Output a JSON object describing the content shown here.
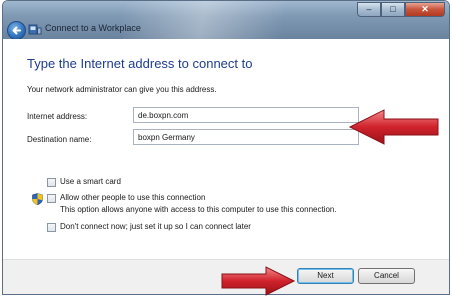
{
  "window": {
    "title": "Connect to a Workplace",
    "caption": {
      "minimize": "–",
      "maximize": "□",
      "close": "✕"
    }
  },
  "icons": {
    "back": "back-arrow-icon",
    "wizard": "network-wizard-icon",
    "shield": "uac-shield-icon",
    "annotation": "red-arrow-icon"
  },
  "main": {
    "heading": "Type the Internet address to connect to",
    "instruction": "Your network administrator can give you this address.",
    "internet_address": {
      "label": "Internet address:",
      "value": "de.boxpn.com"
    },
    "destination_name": {
      "label": "Destination name:",
      "value": "boxpn Germany"
    },
    "options": {
      "smart_card": {
        "label": "Use a smart card",
        "checked": false
      },
      "allow_others": {
        "label": "Allow other people to use this connection",
        "description": "This option allows anyone with access to this computer to use this connection.",
        "checked": false
      },
      "dont_connect": {
        "label": "Don't connect now; just set it up so I can connect later",
        "checked": false
      }
    }
  },
  "footer": {
    "next_label": "Next",
    "cancel_label": "Cancel"
  },
  "colors": {
    "heading": "#1e3d8f",
    "annotation_arrow": "#c0202a",
    "titlebar": "#7f98b3"
  }
}
